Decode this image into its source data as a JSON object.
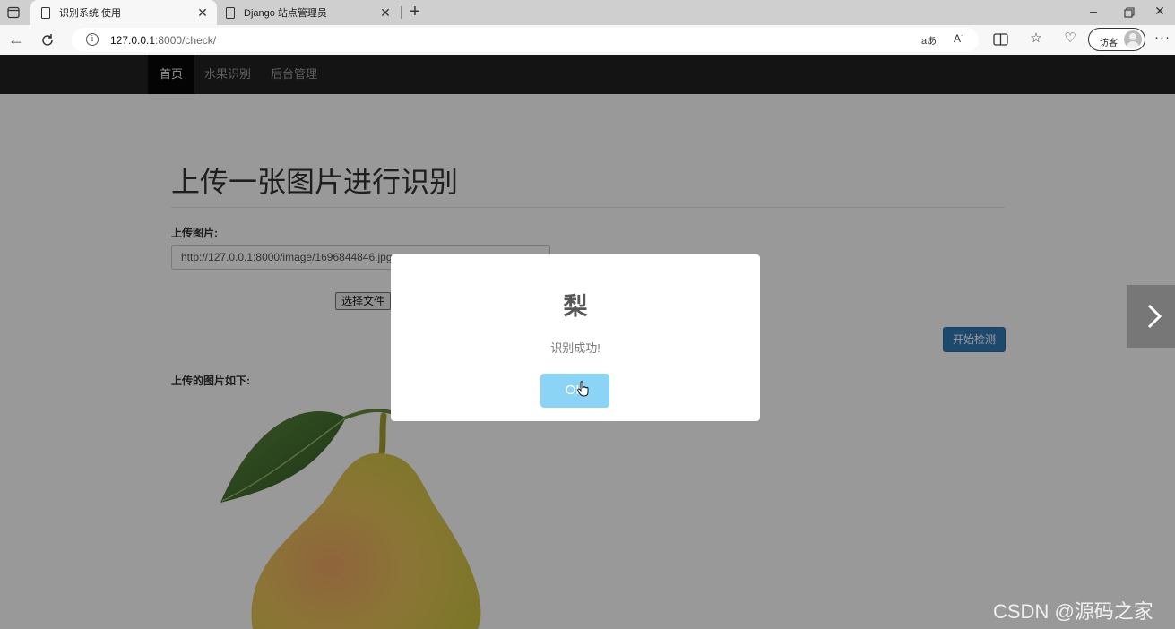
{
  "browser": {
    "tabs": [
      {
        "title": "识别系统 使用",
        "active": true
      },
      {
        "title": "Django 站点管理员",
        "active": false
      }
    ],
    "address": {
      "host": "127.0.0.1",
      "rest": ":8000/check/"
    },
    "read_aloud_label": "aあ",
    "guest_label": "访客",
    "close_glyph": "✕",
    "new_tab_glyph": "+",
    "more_glyph": "···"
  },
  "navbar": {
    "items": [
      {
        "label": "首页",
        "active": true
      },
      {
        "label": "水果识别",
        "active": false
      },
      {
        "label": "后台管理",
        "active": false
      }
    ]
  },
  "main": {
    "heading": "上传一张图片进行识别",
    "upload_label": "上传图片:",
    "image_url": "http://127.0.0.1:8000/image/1696844846.jpg",
    "choose_file_label": "选择文件",
    "detect_button": "开始检测",
    "uploaded_label": "上传的图片如下:"
  },
  "modal": {
    "title": "梨",
    "text": "识别成功!",
    "ok_label": "OK"
  },
  "watermark": "CSDN @源码之家",
  "colors": {
    "navbar_bg": "#222222",
    "primary_button": "#337ab7",
    "ok_button": "#8cd4f5"
  }
}
